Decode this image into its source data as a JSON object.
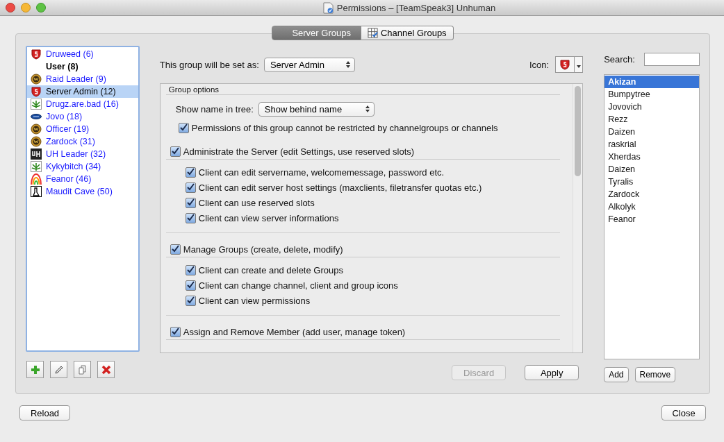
{
  "window": {
    "title": "Permissions – [TeamSpeak3] Unhuman"
  },
  "tabs": [
    {
      "label": "Server Groups",
      "selected": true,
      "kind": "plain"
    },
    {
      "label": "Channel Groups",
      "selected": false,
      "kind": "grid"
    }
  ],
  "groups": [
    {
      "label": "Druweed (6)",
      "kind": "shield",
      "color": "#1a1aff",
      "selected": false,
      "default": false
    },
    {
      "label": "User (8)",
      "kind": "plain",
      "color": "#000000",
      "selected": false,
      "default": true
    },
    {
      "label": "Raid Leader (9)",
      "kind": "medal",
      "color": "#1a1aff",
      "selected": false,
      "default": false
    },
    {
      "label": "Server Admin (12)",
      "kind": "shield",
      "color": "#000000",
      "selected": true,
      "default": false
    },
    {
      "label": "Drugz.are.bad (16)",
      "kind": "leaf",
      "color": "#1a1aff",
      "selected": false,
      "default": false
    },
    {
      "label": "Jovo (18)",
      "kind": "oval",
      "color": "#1a1aff",
      "selected": false,
      "default": false
    },
    {
      "label": "Officer (19)",
      "kind": "medal",
      "color": "#1a1aff",
      "selected": false,
      "default": false
    },
    {
      "label": "Zardock (31)",
      "kind": "medal",
      "color": "#1a1aff",
      "selected": false,
      "default": false
    },
    {
      "label": "UH Leader (32)",
      "kind": "dark",
      "color": "#1a1aff",
      "selected": false,
      "default": false
    },
    {
      "label": "Kykybitch (34)",
      "kind": "leaf",
      "color": "#1a1aff",
      "selected": false,
      "default": false
    },
    {
      "label": "Feanor (46)",
      "kind": "rainbow",
      "color": "#1a1aff",
      "selected": false,
      "default": false
    },
    {
      "label": "Maudit Cave (50)",
      "kind": "tower",
      "color": "#1a1aff",
      "selected": false,
      "default": false
    }
  ],
  "group_tools": [
    {
      "kind": "plus"
    },
    {
      "kind": "pencil"
    },
    {
      "kind": "copy"
    },
    {
      "kind": "cross"
    }
  ],
  "set_as": {
    "label": "This group will be set as:",
    "value": "Server Admin"
  },
  "icon_picker": {
    "label": "Icon:"
  },
  "options": {
    "title": "Group options",
    "show_name": {
      "label": "Show name in tree:",
      "value": "Show behind name"
    },
    "restrict": {
      "label": "Permissions of this group cannot be restricted by channelgroups or channels",
      "checked": true
    },
    "sections": [
      {
        "label": "Administrate the Server (edit Settings, use reserved slots)",
        "checked": true,
        "children": [
          {
            "label": "Client can edit servername, welcomemessage, password etc.",
            "checked": true
          },
          {
            "label": "Client can edit server host settings (maxclients, filetransfer quotas etc.)",
            "checked": true
          },
          {
            "label": "Client can use reserved slots",
            "checked": true
          },
          {
            "label": "Client can view server informations",
            "checked": true
          }
        ]
      },
      {
        "label": "Manage Groups (create, delete, modify)",
        "checked": true,
        "children": [
          {
            "label": "Client can create and delete Groups",
            "checked": true
          },
          {
            "label": "Client can change channel, client and group icons",
            "checked": true
          },
          {
            "label": "Client can view permissions",
            "checked": true
          }
        ]
      },
      {
        "label": "Assign and Remove Member (add user, manage token)",
        "checked": true
      }
    ]
  },
  "actions": [
    {
      "label": "Discard",
      "disabled": true
    },
    {
      "label": "Apply",
      "disabled": false
    }
  ],
  "search": {
    "label": "Search:"
  },
  "members": [
    {
      "label": "Akizan",
      "selected": true
    },
    {
      "label": "Bumpytree",
      "selected": false
    },
    {
      "label": "Jovovich",
      "selected": false
    },
    {
      "label": "Rezz",
      "selected": false
    },
    {
      "label": "Daizen",
      "selected": false
    },
    {
      "label": "raskrial",
      "selected": false
    },
    {
      "label": "Xherdas",
      "selected": false
    },
    {
      "label": "Daizen",
      "selected": false
    },
    {
      "label": "Tyralis",
      "selected": false
    },
    {
      "label": "Zardock",
      "selected": false
    },
    {
      "label": "Alkolyk",
      "selected": false
    },
    {
      "label": "Feanor",
      "selected": false
    }
  ],
  "member_buttons": [
    "Add",
    "Remove"
  ],
  "footer": {
    "left": "Reload",
    "right": "Close"
  }
}
